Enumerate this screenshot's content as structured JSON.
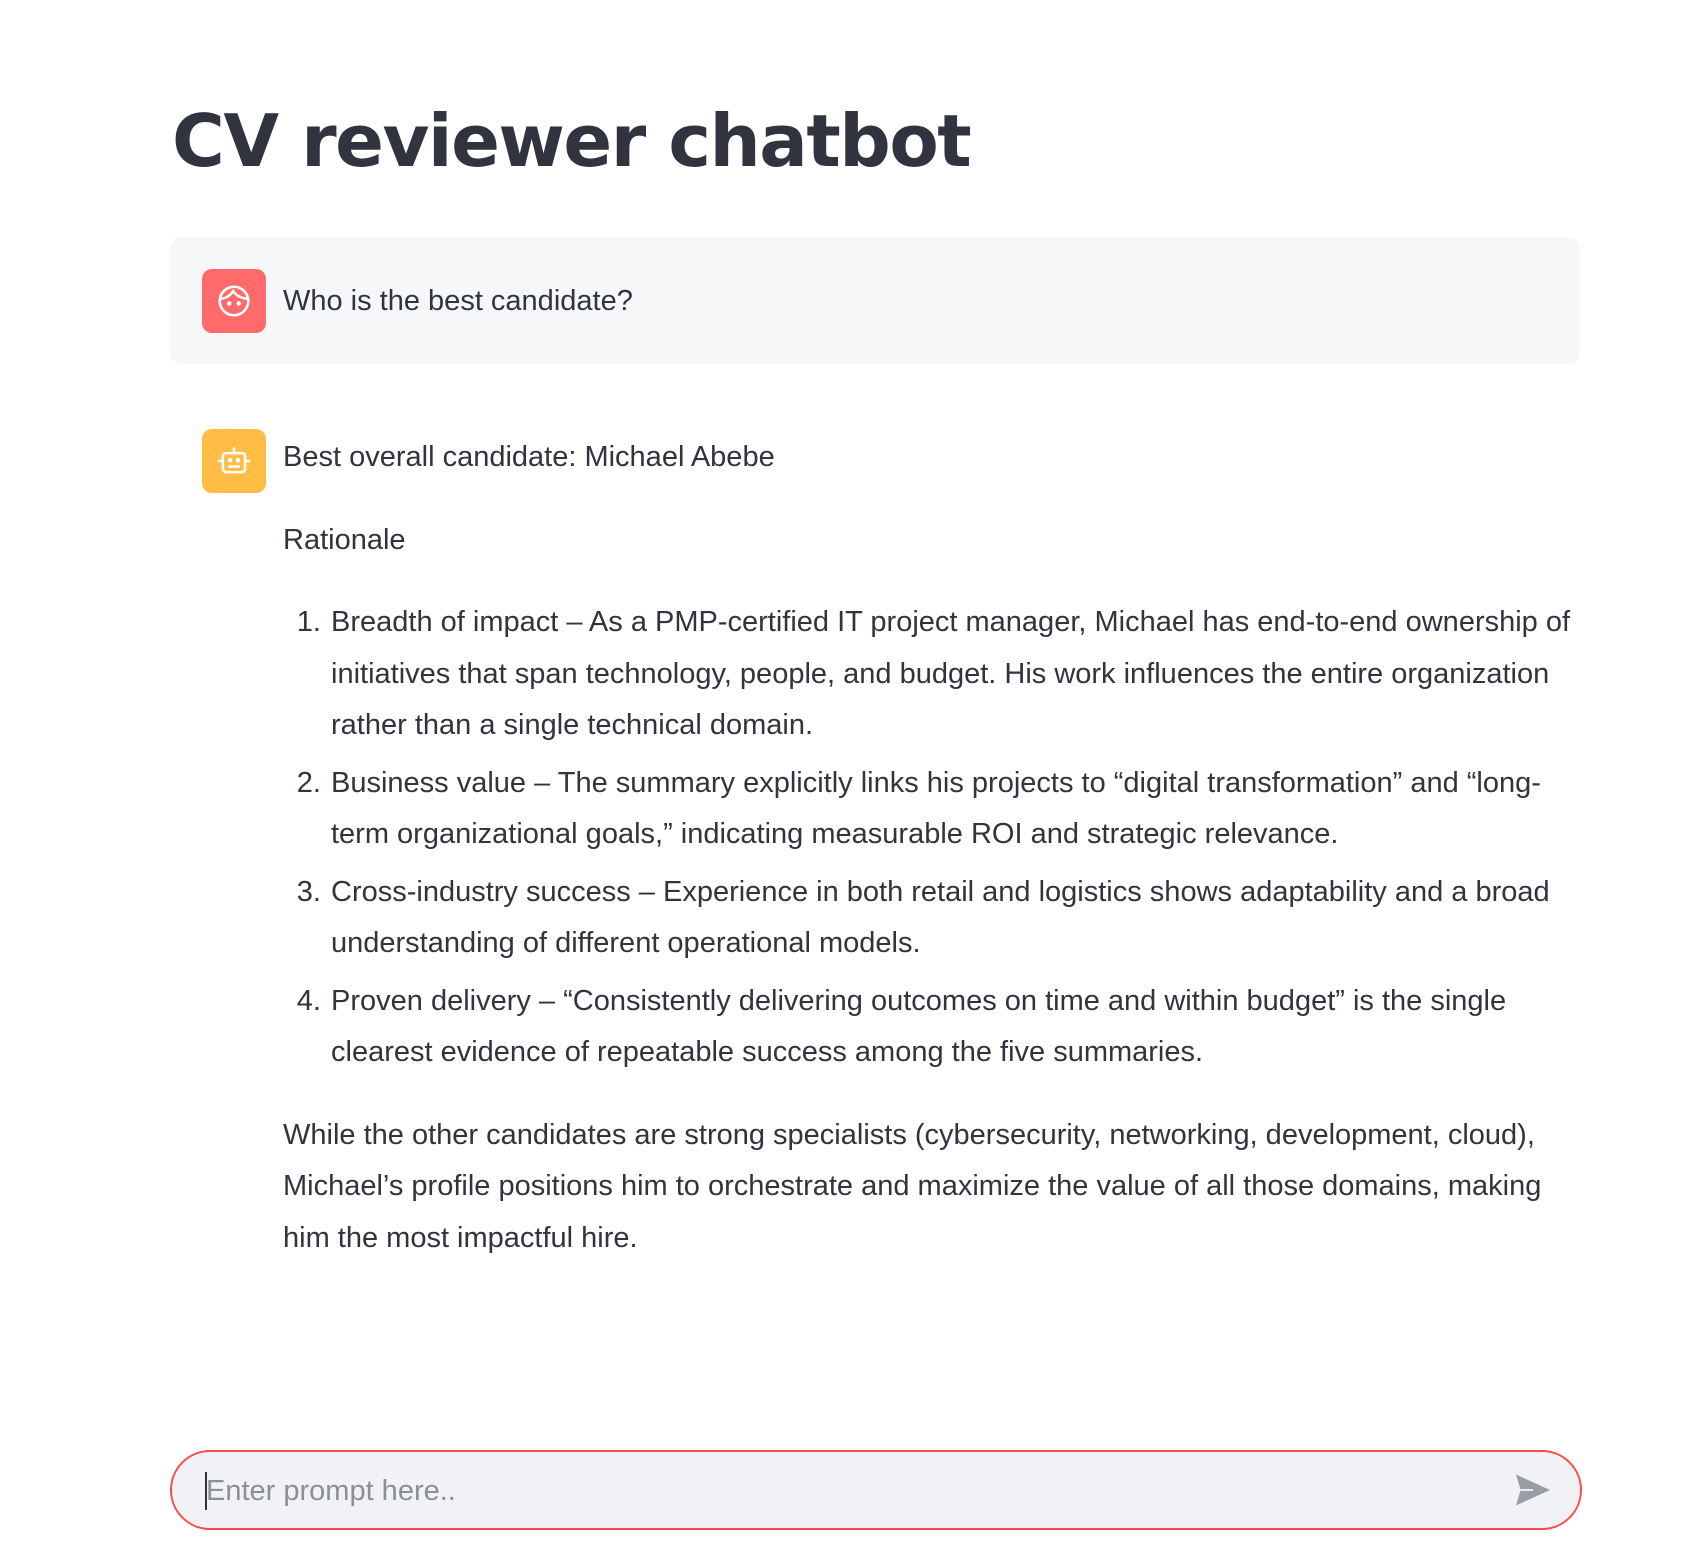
{
  "page": {
    "title": "CV reviewer chatbot"
  },
  "messages": {
    "user": {
      "avatar_icon": "user-face-icon",
      "avatar_color": "#ff6b6b",
      "text": "Who is the best candidate?"
    },
    "assistant": {
      "avatar_icon": "robot-icon",
      "avatar_color": "#ffbd45",
      "heading": "Best overall candidate: Michael Abebe",
      "subheading": "Rationale",
      "points": [
        "Breadth of impact – As a PMP-certified IT project manager, Michael has end-to-end ownership of initiatives that span technology, people, and budget. His work influences the entire organization rather than a single technical domain.",
        "Business value – The summary explicitly links his projects to “digital transformation” and “long-term organizational goals,” indicating measurable ROI and strategic relevance.",
        "Cross-industry success – Experience in both retail and logistics shows adaptability and a broad understanding of different operational models.",
        "Proven delivery – “Consistently delivering outcomes on time and within budget” is the single clearest evidence of repeatable success among the five summaries."
      ],
      "conclusion": "While the other candidates are strong specialists (cybersecurity, networking, development, cloud), Michael’s profile positions him to orchestrate and maximize the value of all those domains, making him the most impactful hire."
    }
  },
  "chat_input": {
    "placeholder": "Enter prompt here..",
    "value": "",
    "border_color": "#ff4b4b",
    "send_icon": "send-icon"
  }
}
